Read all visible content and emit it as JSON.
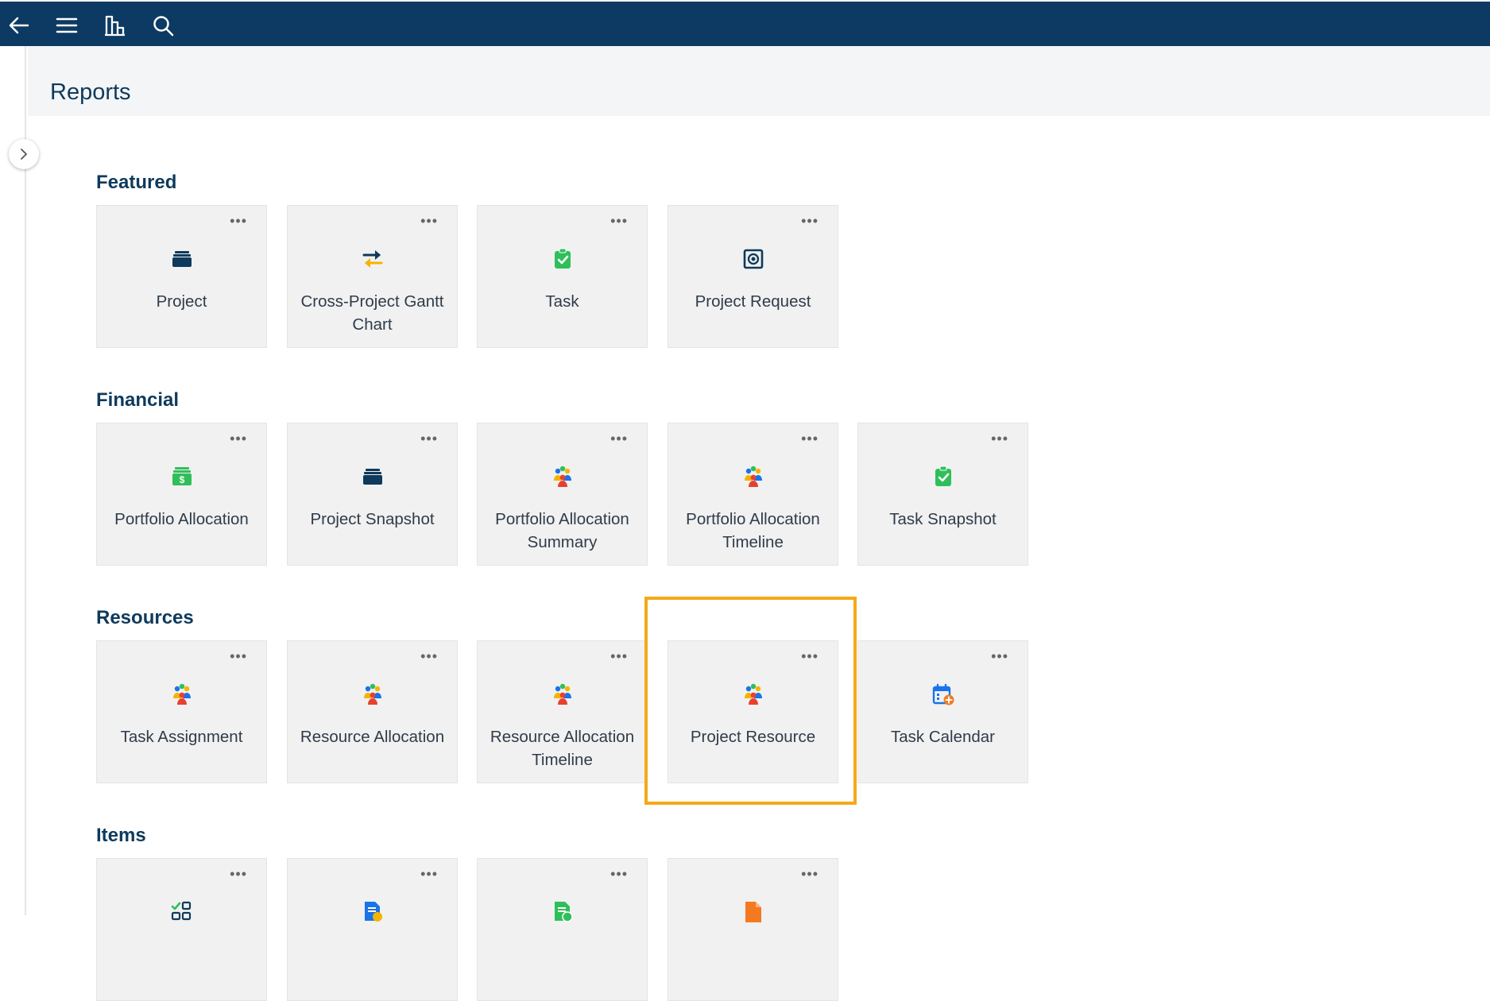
{
  "page": {
    "title": "Reports"
  },
  "topbar": {
    "icons": [
      "back-arrow-icon",
      "hamburger-menu-icon",
      "buildings-icon",
      "search-icon"
    ]
  },
  "sections": {
    "featured": {
      "title": "Featured",
      "cards": [
        {
          "label": "Project",
          "icon": "briefcase-icon"
        },
        {
          "label": "Cross-Project Gantt Chart",
          "icon": "swap-arrows-icon"
        },
        {
          "label": "Task",
          "icon": "clipboard-check-icon"
        },
        {
          "label": "Project Request",
          "icon": "request-icon"
        }
      ]
    },
    "financial": {
      "title": "Financial",
      "cards": [
        {
          "label": "Portfolio Allocation",
          "icon": "money-stack-icon"
        },
        {
          "label": "Project Snapshot",
          "icon": "briefcase-icon"
        },
        {
          "label": "Portfolio Allocation Summary",
          "icon": "people-group-icon"
        },
        {
          "label": "Portfolio Allocation Timeline",
          "icon": "people-group-icon"
        },
        {
          "label": "Task Snapshot",
          "icon": "clipboard-check-icon"
        }
      ]
    },
    "resources": {
      "title": "Resources",
      "cards": [
        {
          "label": "Task Assignment",
          "icon": "people-group-icon"
        },
        {
          "label": "Resource Allocation",
          "icon": "people-group-icon"
        },
        {
          "label": "Resource Allocation Timeline",
          "icon": "people-group-icon"
        },
        {
          "label": "Project Resource",
          "icon": "people-group-icon"
        },
        {
          "label": "Task Calendar",
          "icon": "calendar-add-icon"
        }
      ]
    },
    "items": {
      "title": "Items",
      "cards": [
        {
          "label": "",
          "icon": "checklist-icon"
        },
        {
          "label": "",
          "icon": "document-alert-icon"
        },
        {
          "label": "",
          "icon": "document-check-icon"
        },
        {
          "label": "",
          "icon": "file-icon"
        }
      ]
    }
  },
  "colors": {
    "topbar": "#0c3a63",
    "title_text": "#0e3a5c",
    "card_bg": "#f1f1f1",
    "highlight": "#f5a916",
    "green": "#2fbf5a",
    "navy": "#0e3a5c"
  },
  "card_menu_glyph": "•••"
}
